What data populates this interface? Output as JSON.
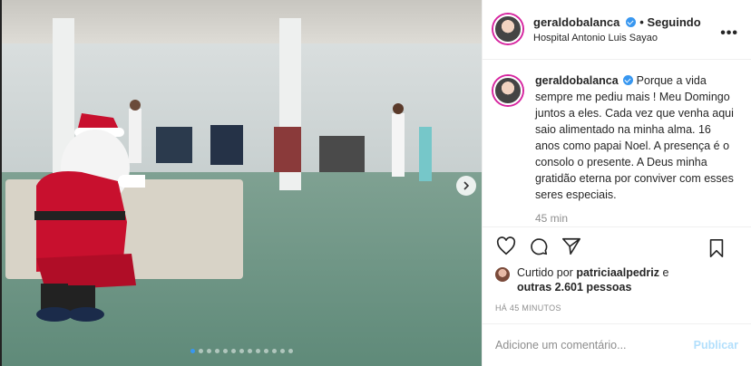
{
  "post": {
    "author": "geraldobalanca",
    "separator": " • ",
    "follow_status": "Seguindo",
    "location": "Hospital Antonio Luis Sayao",
    "more_icon": "ellipsis-icon"
  },
  "caption": {
    "author": "geraldobalanca",
    "text": "Porque a vida sempre me pediu mais ! Meu Domingo juntos a eles. Cada vez que venha aqui saio alimentado na minha alma. 16 anos como papai Noel. A presença é o consolo o presente. A Deus minha gratidão eterna por conviver com esses seres especiais.",
    "time": "45 min"
  },
  "actions": {
    "like_icon": "heart-icon",
    "comment_icon": "comment-icon",
    "share_icon": "paper-plane-icon",
    "save_icon": "bookmark-icon"
  },
  "likes": {
    "prefix": "Curtido por ",
    "liker": "patriciaalpedriz",
    "mid": " e",
    "others": "outras 2.601 pessoas"
  },
  "timestamp": "HÁ 45 MINUTOS",
  "comment": {
    "placeholder": "Adicione um comentário...",
    "publish_label": "Publicar"
  },
  "carousel": {
    "total": 13,
    "active_index": 0,
    "accent": "#3897f0"
  }
}
